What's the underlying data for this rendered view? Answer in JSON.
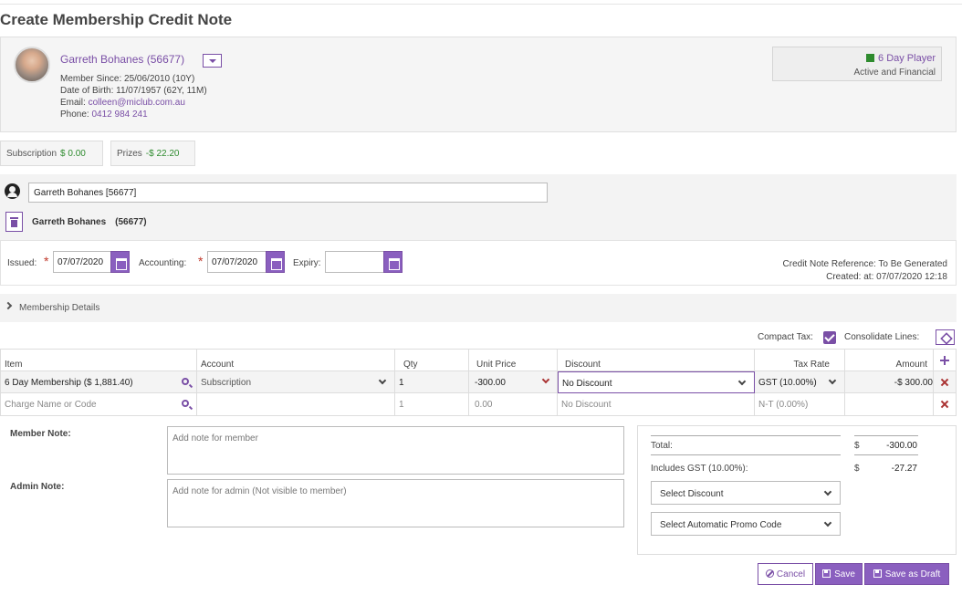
{
  "page": {
    "title": "Create Membership Credit Note"
  },
  "member": {
    "name": "Garreth Bohanes (56677)",
    "since_label": "Member Since:",
    "since": "25/06/2010 (10Y)",
    "dob_label": "Date of Birth:",
    "dob": "11/07/1957 (62Y, 11M)",
    "email_label": "Email:",
    "email": "colleen@miclub.com.au",
    "phone_label": "Phone:",
    "phone": "0412 984 241",
    "status_type": "6 Day Player",
    "status_text": "Active and Financial",
    "status_color": "#2e8b2e"
  },
  "balances": [
    {
      "label": "Subscription",
      "value": "$ 0.00"
    },
    {
      "label": "Prizes",
      "value": "-$ 22.20"
    }
  ],
  "payer": {
    "input_value": "Garreth Bohanes [56677]",
    "name": "Garreth Bohanes",
    "id": "(56677)"
  },
  "dates": {
    "issued_label": "Issued:",
    "issued": "07/07/2020",
    "accounting_label": "Accounting:",
    "accounting": "07/07/2020",
    "expiry_label": "Expiry:",
    "expiry": "",
    "ref_line": "Credit Note Reference: To Be Generated",
    "created_line": "Created:  at: 07/07/2020 12:18"
  },
  "details": {
    "label": "Membership Details"
  },
  "options": {
    "compact_tax": "Compact Tax:",
    "consolidate_lines": "Consolidate Lines:"
  },
  "grid": {
    "headers": {
      "item": "Item",
      "account": "Account",
      "qty": "Qty",
      "unit_price": "Unit Price",
      "discount": "Discount",
      "tax_rate": "Tax Rate",
      "amount": "Amount"
    },
    "rows": [
      {
        "item": "6 Day Membership ($ 1,881.40)",
        "account": "Subscription",
        "qty": "1",
        "unit_price": "-300.00",
        "discount": "No Discount",
        "tax_rate": "GST (10.00%)",
        "amount": "-$ 300.00"
      },
      {
        "item": "Charge Name or Code",
        "account": "",
        "qty": "1",
        "unit_price": "0.00",
        "discount": "No Discount",
        "tax_rate": "N-T (0.00%)",
        "amount": ""
      }
    ]
  },
  "notes": {
    "member_label": "Member Note:",
    "member_placeholder": "Add note for member",
    "admin_label": "Admin Note:",
    "admin_placeholder": "Add note for admin (Not visible to member)"
  },
  "totals": {
    "total_label": "Total:",
    "currency": "$",
    "total": "-300.00",
    "gst_label": "Includes GST (10.00%):",
    "gst": "-27.27",
    "discount_select": "Select Discount",
    "promo_select": "Select Automatic Promo Code"
  },
  "actions": {
    "cancel": "Cancel",
    "save": "Save",
    "save_draft": "Save as Draft"
  },
  "colors": {
    "accent": "#7a4fa6",
    "positive": "#2e8b2e",
    "danger": "#aa3333"
  }
}
